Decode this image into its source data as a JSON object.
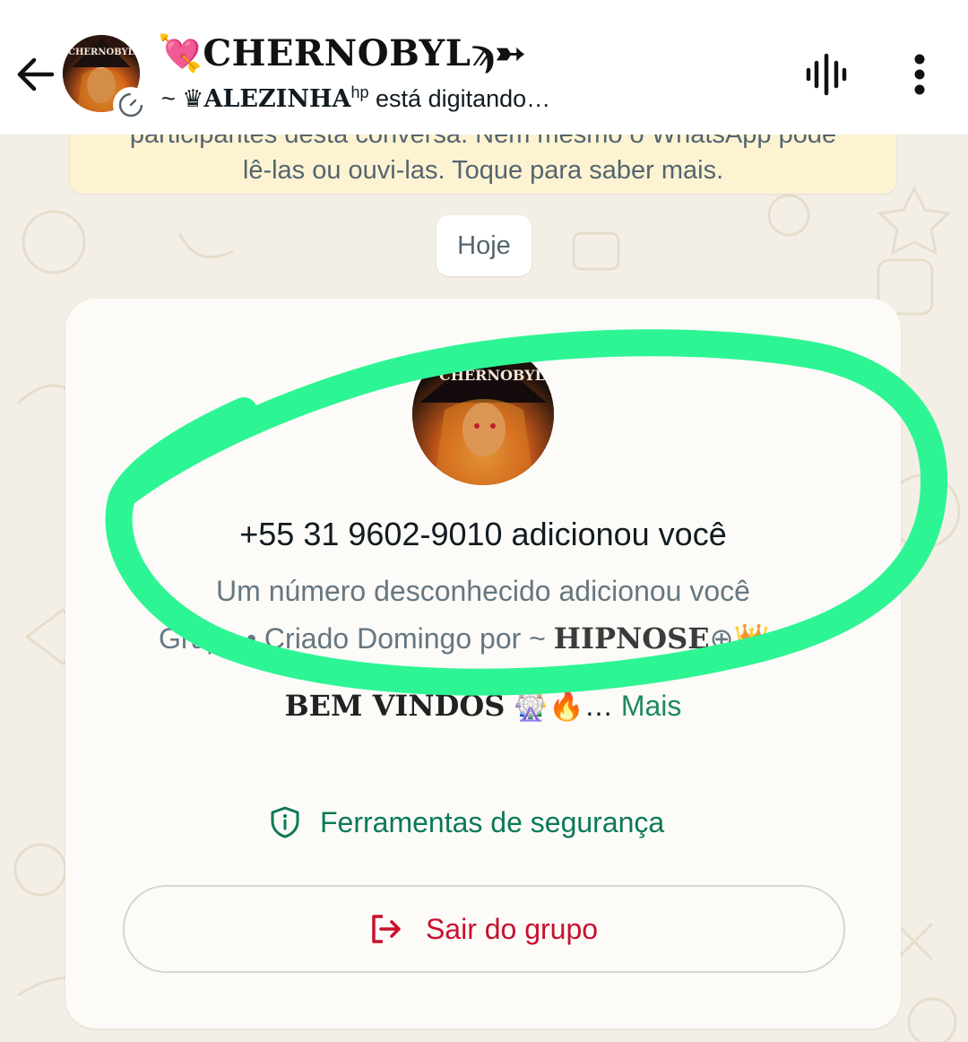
{
  "header": {
    "group_name": "CHERNOBYL",
    "title_heart": "💘",
    "title_tail": "ϡ➳",
    "subtitle_prefix": "~ ♛",
    "typing_user": "ALEZINHA",
    "typing_user_suffix": "hp",
    "typing_status": "está digitando…",
    "avatar_text": "CHERNOBYL"
  },
  "encryption_banner": {
    "line1": "participantes desta conversa. Nem mesmo o WhatsApp pode",
    "line2": "lê-las ou ouvi-las. Toque para saber mais."
  },
  "date_chip": "Hoje",
  "system_card": {
    "avatar_text": "CHERNOBYL",
    "added_by": "+55 31 9602-9010 adicionou você",
    "unknown_number": "Um número desconhecido adicionou você",
    "group_meta_prefix": "Grupo • Criado Domingo por ~",
    "creator_name": "HIPNOSE",
    "creator_emoji": "⊕👑",
    "description": "BEM VINDOS",
    "description_emoji": "🎡🔥",
    "description_ellipsis": "…",
    "more_label": "Mais",
    "safety_tools_label": "Ferramentas de segurança",
    "exit_group_label": "Sair do grupo"
  },
  "colors": {
    "accent_green": "#1e8a5b",
    "exit_red": "#c8102e",
    "annotation_green": "#2ef594",
    "banner_yellow": "#fdf3d3"
  },
  "icons": [
    "back-arrow-icon",
    "timer-icon",
    "voice-wave-icon",
    "more-vertical-icon",
    "shield-icon",
    "exit-icon"
  ]
}
